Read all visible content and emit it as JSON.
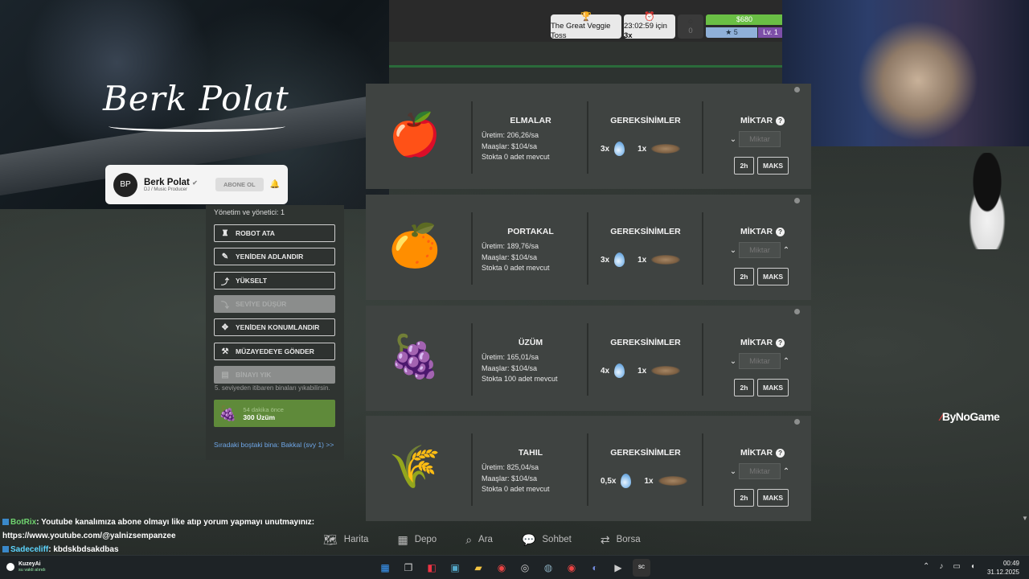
{
  "hud": {
    "event_label": "The Great Veggie Toss",
    "timer_label": "23:02:59 için",
    "timer_multiplier": "3x",
    "empty_value": "0",
    "money": "$680",
    "stars": "5",
    "level": "Lv. 1"
  },
  "overlay": {
    "banner_name": "Berk Polat",
    "channel_name": "Berk Polat",
    "channel_sub": "DJ / Music Producer",
    "subscribe_label": "ABONE OL"
  },
  "panel": {
    "managers": "Yönetim ve yönetici: 1",
    "buttons": [
      {
        "label": "ROBOT ATA",
        "icon": "robot-icon",
        "disabled": false
      },
      {
        "label": "YENİDEN ADLANDIR",
        "icon": "edit-icon",
        "disabled": false
      },
      {
        "label": "YÜKSELT",
        "icon": "upgrade-icon",
        "disabled": false
      },
      {
        "label": "SEVİYE DÜŞÜR",
        "icon": "downgrade-icon",
        "disabled": true
      },
      {
        "label": "YENİDEN KONUMLANDIR",
        "icon": "move-icon",
        "disabled": false
      },
      {
        "label": "MÜZAYEDEYE GÖNDER",
        "icon": "hammer-icon",
        "disabled": false
      },
      {
        "label": "BİNAYI YIK",
        "icon": "demolish-icon",
        "disabled": true
      }
    ],
    "demolish_note": "5. seviyeden itibaren binaları yıkabilirsin.",
    "stock_time": "54 dakika önce",
    "stock_amount": "300 Üzüm",
    "next_building": "Sıradaki boştaki bina: Bakkal (svy 1) >>"
  },
  "table_headers": {
    "requirements": "GEREKSİNİMLER",
    "amount": "MİKTAR",
    "amount_placeholder": "Miktar",
    "btn_2h": "2h",
    "btn_max": "MAKS"
  },
  "products": [
    {
      "name": "ELMALAR",
      "icon": "apple-icon",
      "production": "Üretim: 206,26/sa",
      "wages": "Maaşlar: $104/sa",
      "stock": "Stokta 0 adet mevcut",
      "water": "3x",
      "seed": "1x"
    },
    {
      "name": "PORTAKAL",
      "icon": "orange-icon",
      "production": "Üretim: 189,76/sa",
      "wages": "Maaşlar: $104/sa",
      "stock": "Stokta 0 adet mevcut",
      "water": "3x",
      "seed": "1x"
    },
    {
      "name": "ÜZÜM",
      "icon": "grape-icon",
      "production": "Üretim: 165,01/sa",
      "wages": "Maaşlar: $104/sa",
      "stock": "Stokta 100 adet mevcut",
      "water": "4x",
      "seed": "1x"
    },
    {
      "name": "TAHIL",
      "icon": "wheat-icon",
      "production": "Üretim: 825,04/sa",
      "wages": "Maaşlar: $104/sa",
      "stock": "Stokta 0 adet mevcut",
      "water": "0,5x",
      "seed": "1x"
    }
  ],
  "nav": [
    "Harita",
    "Depo",
    "Ara",
    "Sohbet",
    "Borsa"
  ],
  "chat": [
    {
      "user": "BotRix",
      "text": ": Youtube kanalımıza abone olmayı like atıp yorum yapmayı unutmayınız:"
    },
    {
      "user": "",
      "text": "https://www.youtube.com/@yalnizsempanzee"
    },
    {
      "user": "Sadeceliff",
      "text": ": kbdskbdsakdbas"
    }
  ],
  "watermark": "ByNoGame",
  "taskbar": {
    "user": "KuzeyAi",
    "user_status": "su vakti alındı",
    "time": "00:49",
    "date": "31.12.2025"
  }
}
